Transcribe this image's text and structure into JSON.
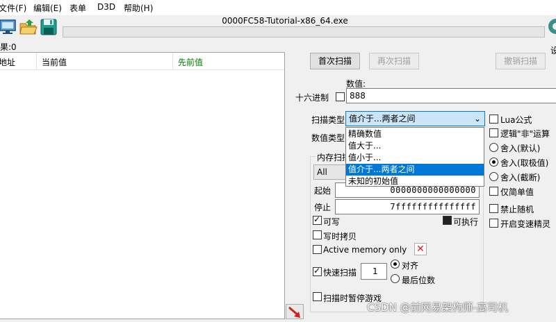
{
  "menu": [
    "文件(F)",
    "编辑(E)",
    "表单",
    "D3D",
    "帮助(H)"
  ],
  "window_title": "0000FC58-Tutorial-x86_64.exe",
  "found_label": "果:0",
  "columns": [
    "地址",
    "当前值",
    "先前值"
  ],
  "previous_value_color": "#008000",
  "buttons": {
    "first_scan": "首次扫描",
    "next_scan": "再次扫描",
    "undo_scan": "撤销扫描"
  },
  "value_label": "数值:",
  "hex_label": "十六进制",
  "value_input": "888",
  "scan_type_label": "扫描类型",
  "scan_type_selected": "值介于...两者之间",
  "scan_type_options": [
    "精确数值",
    "值大于...",
    "值小于...",
    "值介于...两者之间",
    "未知的初始值"
  ],
  "scan_type_selected_index": 3,
  "value_type_label": "数值类型",
  "memory_scan_label": "内存扫描",
  "memory_region": "All",
  "start_label": "起始",
  "start_value": "0000000000000000",
  "stop_label": "停止",
  "stop_value": "7fffffffffffffff",
  "writable_label": "可写",
  "executable_label": "可执行",
  "copy_on_write_label": "写时拷贝",
  "active_memory_label": "Active memory only",
  "fast_scan_label": "快速扫描",
  "fast_scan_value": "1",
  "align_label": "对齐",
  "last_digits_label": "最后位数",
  "pause_game_label": "扫描时暂停游戏",
  "right_options": {
    "lua": "Lua公式",
    "not_logic": "逻辑\"非\"运算",
    "round_default": "舍入(默认)",
    "round_extreme": "舍入(取极值)",
    "round_truncate": "舍入(截断)",
    "simple_values": "仅简单值",
    "disable_random": "禁止随机",
    "speedhack": "开启变速精灵"
  },
  "settings_partial": "设",
  "watermark": "CSDN @前网易架构师-高司机"
}
